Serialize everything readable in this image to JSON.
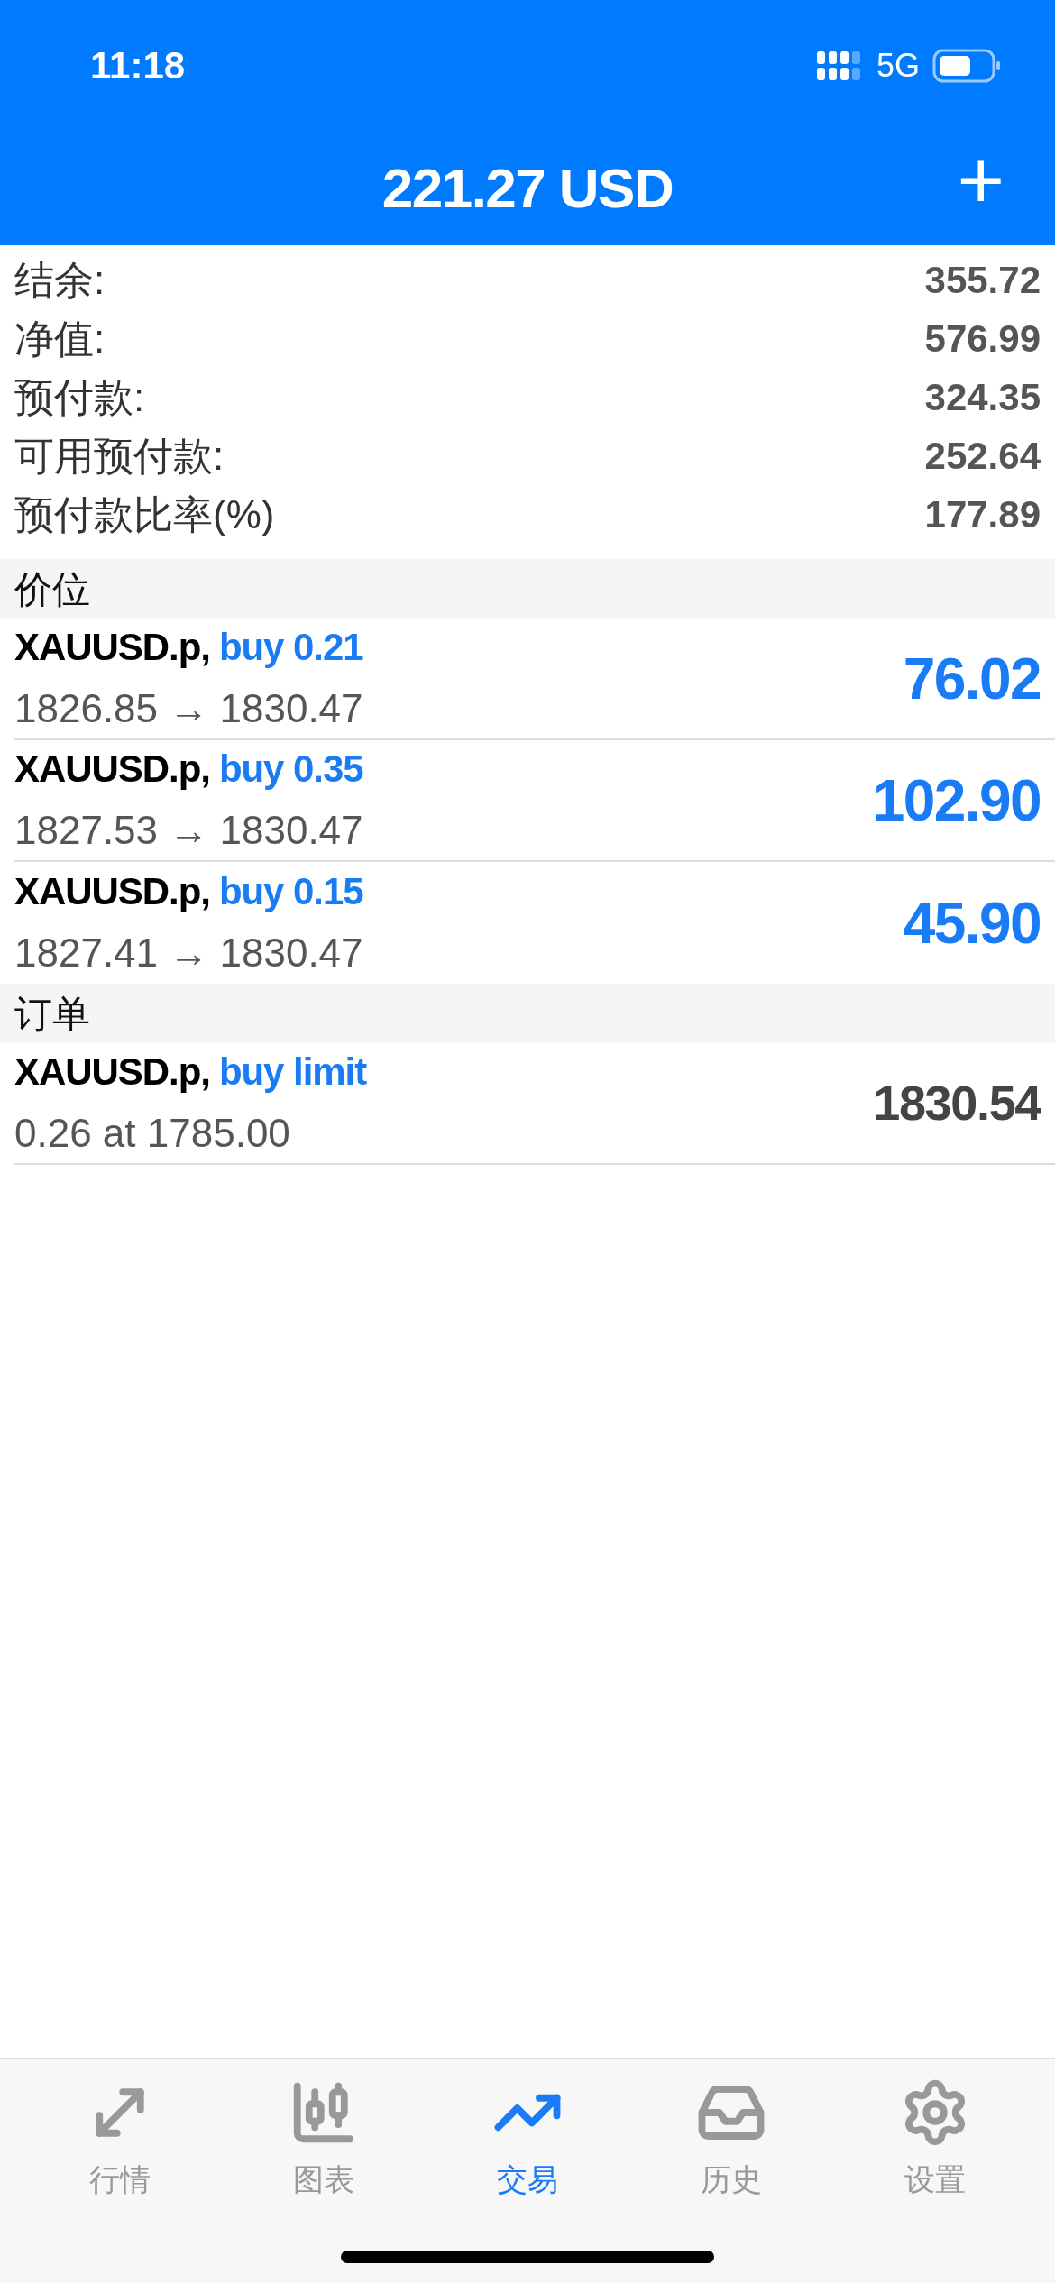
{
  "status_bar": {
    "time": "11:18",
    "network": "5G"
  },
  "header": {
    "title": "221.27 USD",
    "add_button": "+"
  },
  "summary": [
    {
      "label": "结余:",
      "value": "355.72"
    },
    {
      "label": "净值:",
      "value": "576.99"
    },
    {
      "label": "预付款:",
      "value": "324.35"
    },
    {
      "label": "可用预付款:",
      "value": "252.64"
    },
    {
      "label": "预付款比率(%)",
      "value": "177.89"
    }
  ],
  "sections": [
    {
      "title": "价位",
      "items": [
        {
          "kind": "position",
          "symbol": "XAUUSD.p,",
          "side": "buy 0.21",
          "detail": "1826.85 → 1830.47",
          "amount": "76.02"
        },
        {
          "kind": "position",
          "symbol": "XAUUSD.p,",
          "side": "buy 0.35",
          "detail": "1827.53 → 1830.47",
          "amount": "102.90"
        },
        {
          "kind": "position",
          "symbol": "XAUUSD.p,",
          "side": "buy 0.15",
          "detail": "1827.41 → 1830.47",
          "amount": "45.90"
        }
      ]
    },
    {
      "title": "订单",
      "items": [
        {
          "kind": "order",
          "symbol": "XAUUSD.p,",
          "side": "buy limit",
          "detail": "0.26 at 1785.00",
          "amount": "1830.54"
        }
      ]
    }
  ],
  "tabs": [
    {
      "label": "行情",
      "selected": false
    },
    {
      "label": "图表",
      "selected": false
    },
    {
      "label": "交易",
      "selected": true
    },
    {
      "label": "历史",
      "selected": false
    },
    {
      "label": "设置",
      "selected": false
    }
  ]
}
